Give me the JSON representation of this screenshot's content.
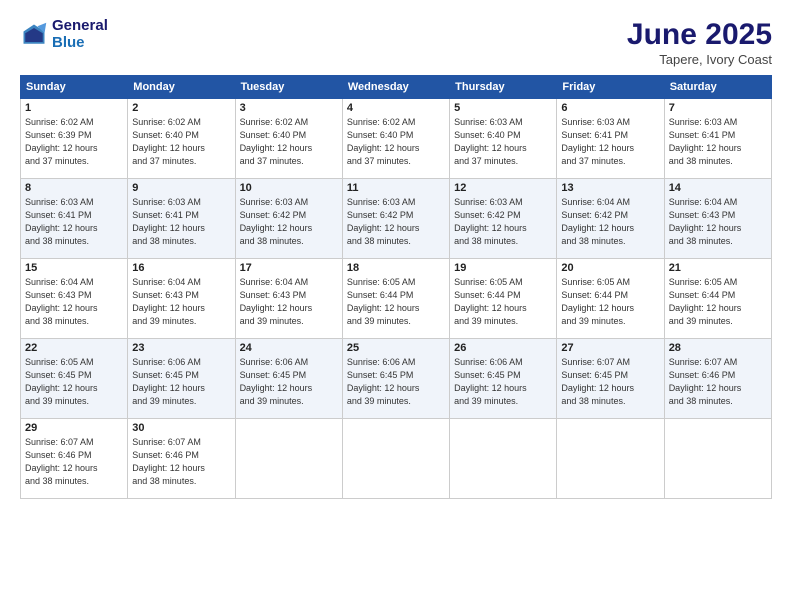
{
  "logo": {
    "line1": "General",
    "line2": "Blue"
  },
  "title": "June 2025",
  "location": "Tapere, Ivory Coast",
  "weekdays": [
    "Sunday",
    "Monday",
    "Tuesday",
    "Wednesday",
    "Thursday",
    "Friday",
    "Saturday"
  ],
  "weeks": [
    [
      {
        "day": "1",
        "info": "Sunrise: 6:02 AM\nSunset: 6:39 PM\nDaylight: 12 hours\nand 37 minutes."
      },
      {
        "day": "2",
        "info": "Sunrise: 6:02 AM\nSunset: 6:40 PM\nDaylight: 12 hours\nand 37 minutes."
      },
      {
        "day": "3",
        "info": "Sunrise: 6:02 AM\nSunset: 6:40 PM\nDaylight: 12 hours\nand 37 minutes."
      },
      {
        "day": "4",
        "info": "Sunrise: 6:02 AM\nSunset: 6:40 PM\nDaylight: 12 hours\nand 37 minutes."
      },
      {
        "day": "5",
        "info": "Sunrise: 6:03 AM\nSunset: 6:40 PM\nDaylight: 12 hours\nand 37 minutes."
      },
      {
        "day": "6",
        "info": "Sunrise: 6:03 AM\nSunset: 6:41 PM\nDaylight: 12 hours\nand 37 minutes."
      },
      {
        "day": "7",
        "info": "Sunrise: 6:03 AM\nSunset: 6:41 PM\nDaylight: 12 hours\nand 38 minutes."
      }
    ],
    [
      {
        "day": "8",
        "info": "Sunrise: 6:03 AM\nSunset: 6:41 PM\nDaylight: 12 hours\nand 38 minutes."
      },
      {
        "day": "9",
        "info": "Sunrise: 6:03 AM\nSunset: 6:41 PM\nDaylight: 12 hours\nand 38 minutes."
      },
      {
        "day": "10",
        "info": "Sunrise: 6:03 AM\nSunset: 6:42 PM\nDaylight: 12 hours\nand 38 minutes."
      },
      {
        "day": "11",
        "info": "Sunrise: 6:03 AM\nSunset: 6:42 PM\nDaylight: 12 hours\nand 38 minutes."
      },
      {
        "day": "12",
        "info": "Sunrise: 6:03 AM\nSunset: 6:42 PM\nDaylight: 12 hours\nand 38 minutes."
      },
      {
        "day": "13",
        "info": "Sunrise: 6:04 AM\nSunset: 6:42 PM\nDaylight: 12 hours\nand 38 minutes."
      },
      {
        "day": "14",
        "info": "Sunrise: 6:04 AM\nSunset: 6:43 PM\nDaylight: 12 hours\nand 38 minutes."
      }
    ],
    [
      {
        "day": "15",
        "info": "Sunrise: 6:04 AM\nSunset: 6:43 PM\nDaylight: 12 hours\nand 38 minutes."
      },
      {
        "day": "16",
        "info": "Sunrise: 6:04 AM\nSunset: 6:43 PM\nDaylight: 12 hours\nand 39 minutes."
      },
      {
        "day": "17",
        "info": "Sunrise: 6:04 AM\nSunset: 6:43 PM\nDaylight: 12 hours\nand 39 minutes."
      },
      {
        "day": "18",
        "info": "Sunrise: 6:05 AM\nSunset: 6:44 PM\nDaylight: 12 hours\nand 39 minutes."
      },
      {
        "day": "19",
        "info": "Sunrise: 6:05 AM\nSunset: 6:44 PM\nDaylight: 12 hours\nand 39 minutes."
      },
      {
        "day": "20",
        "info": "Sunrise: 6:05 AM\nSunset: 6:44 PM\nDaylight: 12 hours\nand 39 minutes."
      },
      {
        "day": "21",
        "info": "Sunrise: 6:05 AM\nSunset: 6:44 PM\nDaylight: 12 hours\nand 39 minutes."
      }
    ],
    [
      {
        "day": "22",
        "info": "Sunrise: 6:05 AM\nSunset: 6:45 PM\nDaylight: 12 hours\nand 39 minutes."
      },
      {
        "day": "23",
        "info": "Sunrise: 6:06 AM\nSunset: 6:45 PM\nDaylight: 12 hours\nand 39 minutes."
      },
      {
        "day": "24",
        "info": "Sunrise: 6:06 AM\nSunset: 6:45 PM\nDaylight: 12 hours\nand 39 minutes."
      },
      {
        "day": "25",
        "info": "Sunrise: 6:06 AM\nSunset: 6:45 PM\nDaylight: 12 hours\nand 39 minutes."
      },
      {
        "day": "26",
        "info": "Sunrise: 6:06 AM\nSunset: 6:45 PM\nDaylight: 12 hours\nand 39 minutes."
      },
      {
        "day": "27",
        "info": "Sunrise: 6:07 AM\nSunset: 6:45 PM\nDaylight: 12 hours\nand 38 minutes."
      },
      {
        "day": "28",
        "info": "Sunrise: 6:07 AM\nSunset: 6:46 PM\nDaylight: 12 hours\nand 38 minutes."
      }
    ],
    [
      {
        "day": "29",
        "info": "Sunrise: 6:07 AM\nSunset: 6:46 PM\nDaylight: 12 hours\nand 38 minutes."
      },
      {
        "day": "30",
        "info": "Sunrise: 6:07 AM\nSunset: 6:46 PM\nDaylight: 12 hours\nand 38 minutes."
      },
      {
        "day": "",
        "info": ""
      },
      {
        "day": "",
        "info": ""
      },
      {
        "day": "",
        "info": ""
      },
      {
        "day": "",
        "info": ""
      },
      {
        "day": "",
        "info": ""
      }
    ]
  ]
}
